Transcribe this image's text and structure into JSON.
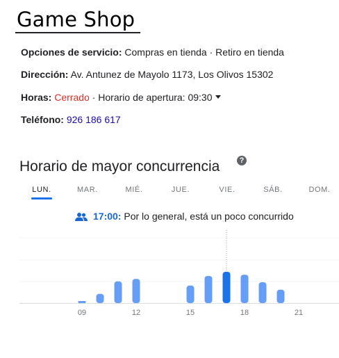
{
  "title": "Game Shop",
  "info": {
    "service": {
      "label": "Opciones de servicio:",
      "value": "Compras en tienda · Retiro en tienda"
    },
    "address": {
      "label": "Dirección:",
      "value": "Av. Antunez de Mayolo 1173, Los Olivos 15302"
    },
    "hours": {
      "label": "Horas:",
      "status": "Cerrado",
      "value": " · Horario de apertura: 09:30"
    },
    "phone": {
      "label": "Teléfono:",
      "value": "926 186 617"
    }
  },
  "popular": {
    "title": "Horario de mayor concurrencia",
    "days": [
      "LUN.",
      "MAR.",
      "MIÉ.",
      "JUE.",
      "VIE.",
      "SÁB.",
      "DOM."
    ],
    "active_day": "LUN.",
    "live": {
      "time": "17:00:",
      "text": " Por lo general, está un poco concurrido"
    }
  },
  "colors": {
    "bar": "#669df6",
    "bar_active": "#1a73e8",
    "link": "#1a0dab",
    "closed": "#d93025"
  },
  "chart_data": {
    "type": "bar",
    "categories": [
      "09",
      "10",
      "11",
      "12",
      "13",
      "14",
      "15",
      "16",
      "17",
      "18",
      "19",
      "20",
      "21"
    ],
    "values": [
      2,
      22,
      52,
      58,
      0,
      0,
      42,
      65,
      75,
      68,
      50,
      32,
      0
    ],
    "highlight": "17",
    "x_tick_labels": [
      "09",
      "12",
      "15",
      "18",
      "21"
    ],
    "ylim": [
      0,
      100
    ]
  }
}
